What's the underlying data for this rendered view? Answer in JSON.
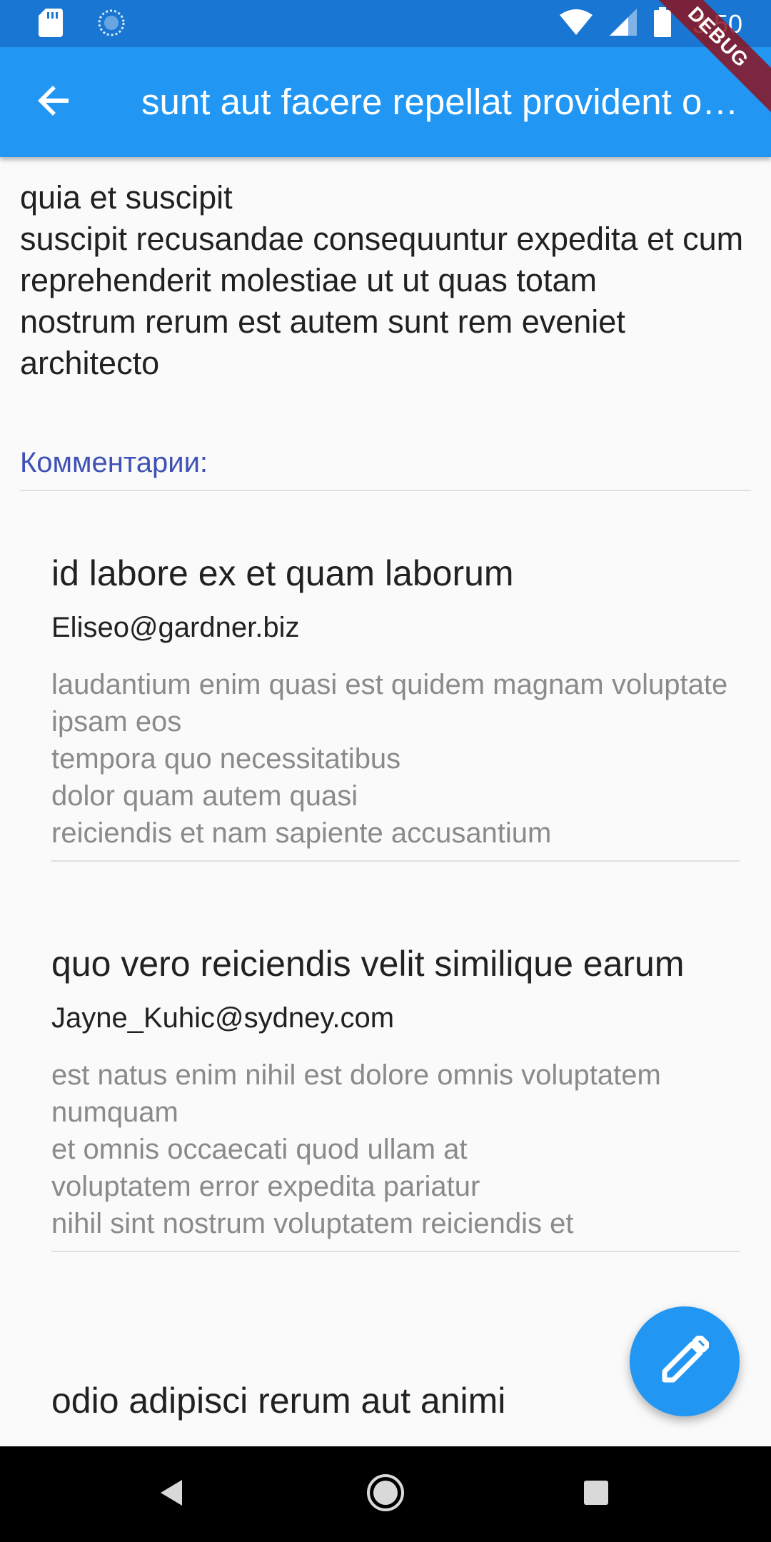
{
  "status_bar": {
    "time": "3:50",
    "icons": [
      "sd-card-icon",
      "sync-icon",
      "wifi-icon",
      "signal-icon",
      "battery-icon"
    ]
  },
  "debug_banner": "DEBUG",
  "app_bar": {
    "title": "sunt aut facere repellat provident occaecati excepturi optio reprehenderit",
    "back_icon": "arrow-back-icon",
    "background": "#2196f3"
  },
  "post": {
    "body": "quia et suscipit\nsuscipit recusandae consequuntur expedita et cum\nreprehenderit molestiae ut ut quas totam\nnostrum rerum est autem sunt rem eveniet architecto"
  },
  "comments": {
    "heading": "Комментарии:",
    "items": [
      {
        "title": "id labore ex et quam laborum",
        "email": "Eliseo@gardner.biz",
        "body": "laudantium enim quasi est quidem magnam voluptate ipsam eos\ntempora quo necessitatibus\ndolor quam autem quasi\nreiciendis et nam sapiente accusantium"
      },
      {
        "title": "quo vero reiciendis velit similique earum",
        "email": "Jayne_Kuhic@sydney.com",
        "body": "est natus enim nihil est dolore omnis voluptatem numquam\net omnis occaecati quod ullam at\nvoluptatem error expedita pariatur\nnihil sint nostrum voluptatem reiciendis et"
      },
      {
        "title": "odio adipisci rerum aut animi",
        "email": "",
        "body": ""
      }
    ]
  },
  "fab": {
    "icon": "edit-pencil-icon"
  },
  "nav_bar": {
    "icons": [
      "nav-back-icon",
      "nav-home-icon",
      "nav-recents-icon"
    ]
  }
}
